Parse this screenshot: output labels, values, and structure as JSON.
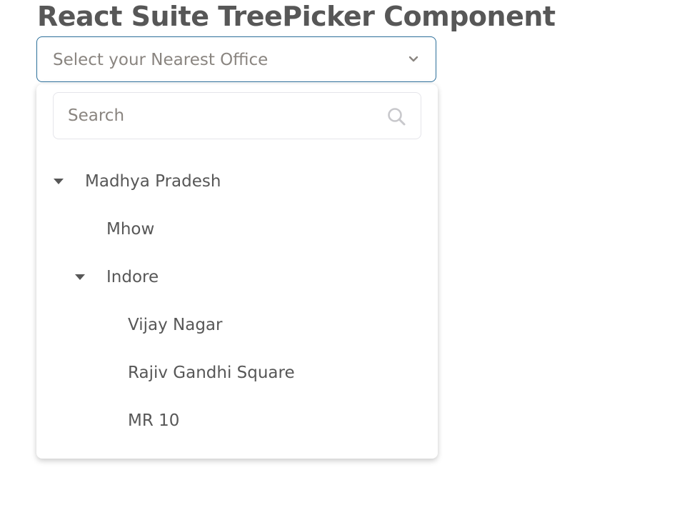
{
  "page": {
    "title": "React Suite TreePicker Component"
  },
  "picker": {
    "placeholder": "Select your Nearest Office"
  },
  "search": {
    "placeholder": "Search",
    "value": ""
  },
  "tree": {
    "root": {
      "label": "Madhya Pradesh",
      "expanded": true
    },
    "mhow": {
      "label": "Mhow"
    },
    "indore": {
      "label": "Indore",
      "expanded": true
    },
    "vijay_nagar": {
      "label": "Vijay Nagar"
    },
    "rajiv_gandhi_square": {
      "label": "Rajiv Gandhi Square"
    },
    "mr10": {
      "label": "MR 10"
    }
  },
  "icons": {
    "caret": "chevron-down-icon",
    "search": "search-icon",
    "expand": "caret-down-icon"
  },
  "colors": {
    "title": "#575757",
    "toggle_border": "#2c6f9a",
    "placeholder": "#8a8580",
    "text": "#575757"
  }
}
